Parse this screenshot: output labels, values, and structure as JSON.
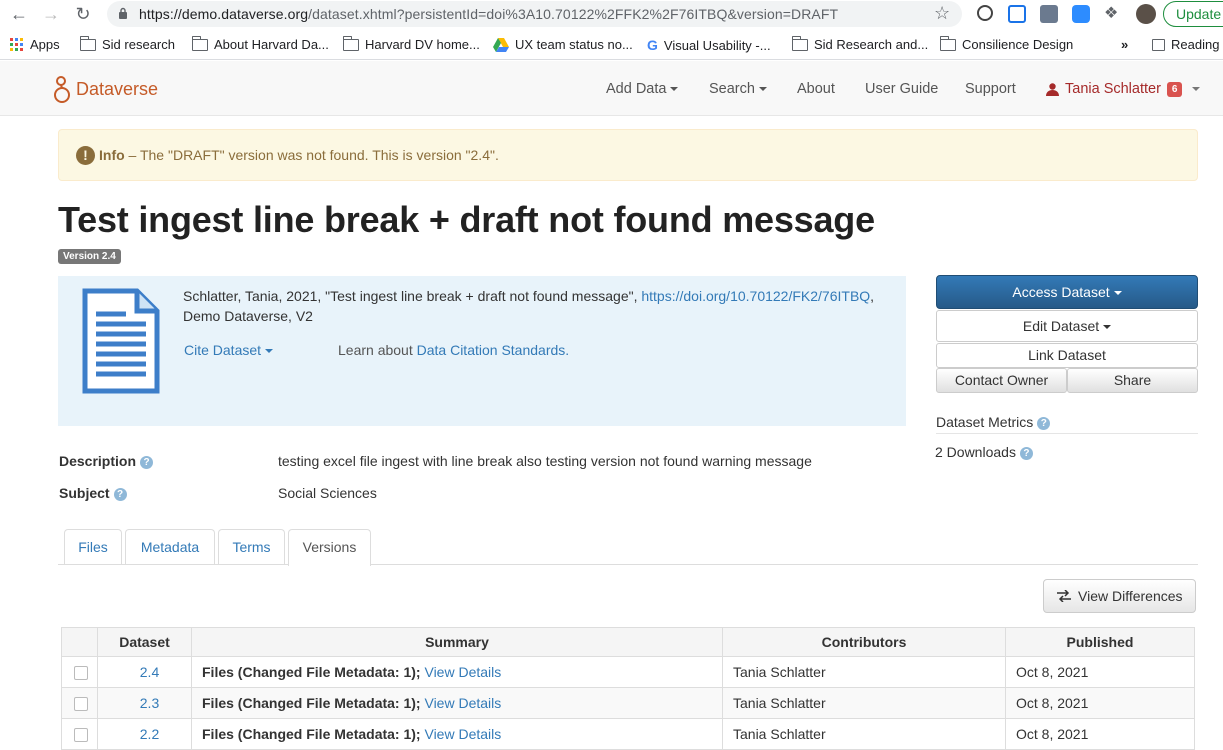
{
  "browser": {
    "url_host": "https://demo.dataverse.org",
    "url_path": "/dataset.xhtml?persistentId=doi%3A10.70122%2FFK2%2F76ITBQ&version=DRAFT",
    "update_label": "Update",
    "bookmarks": [
      "Apps",
      "Sid research",
      "About Harvard Da...",
      "Harvard DV home...",
      "UX team status no...",
      "Visual Usability -...",
      "Sid Research and...",
      "Consilience Design"
    ],
    "overflow": "»",
    "reading_label": "Reading"
  },
  "navbar": {
    "brand": "Dataverse",
    "items": [
      "Add Data",
      "Search",
      "About",
      "User Guide",
      "Support"
    ],
    "user": "Tania Schlatter",
    "notification_count": "6"
  },
  "alert": {
    "label": "Info",
    "message": " – The \"DRAFT\" version was not found. This is version \"2.4\"."
  },
  "dataset": {
    "title": "Test ingest line break + draft not found message",
    "version_label": "Version 2.4",
    "citation_text": "Schlatter, Tania, 2021, \"Test ingest line break + draft not found message\", ",
    "citation_doi": "https://doi.org/10.70122/FK2/76ITBQ",
    "citation_tail": ",",
    "citation_line2": "Demo Dataverse, V2",
    "cite_button": "Cite Dataset",
    "learn_prefix": "Learn about ",
    "learn_link": "Data Citation Standards."
  },
  "actions": {
    "access": "Access Dataset",
    "edit": "Edit Dataset",
    "link": "Link Dataset",
    "contact": "Contact Owner",
    "share": "Share",
    "metrics_label": "Dataset Metrics",
    "downloads": "2 Downloads"
  },
  "metadata": {
    "description_label": "Description",
    "description_value": "testing excel file ingest with line break also testing version not found warning message",
    "subject_label": "Subject",
    "subject_value": "Social Sciences"
  },
  "tabs": [
    "Files",
    "Metadata",
    "Terms",
    "Versions"
  ],
  "view_differences": "View Differences",
  "versions_table": {
    "headers": [
      "Dataset",
      "Summary",
      "Contributors",
      "Published"
    ],
    "rows": [
      {
        "version": "2.4",
        "summary_bold": "Files (Changed File Metadata: 1);",
        "summary_link": "View Details",
        "contributor": "Tania Schlatter",
        "published": "Oct 8, 2021"
      },
      {
        "version": "2.3",
        "summary_bold": "Files (Changed File Metadata: 1);",
        "summary_link": "View Details",
        "contributor": "Tania Schlatter",
        "published": "Oct 8, 2021"
      },
      {
        "version": "2.2",
        "summary_bold": "Files (Changed File Metadata: 1);",
        "summary_link": "View Details",
        "contributor": "Tania Schlatter",
        "published": "Oct 8, 2021"
      }
    ]
  },
  "colors": {
    "brand": "#c55b28",
    "link": "#337ab7",
    "primary": "#2e6da4",
    "alert_bg": "#fcf8e3"
  }
}
